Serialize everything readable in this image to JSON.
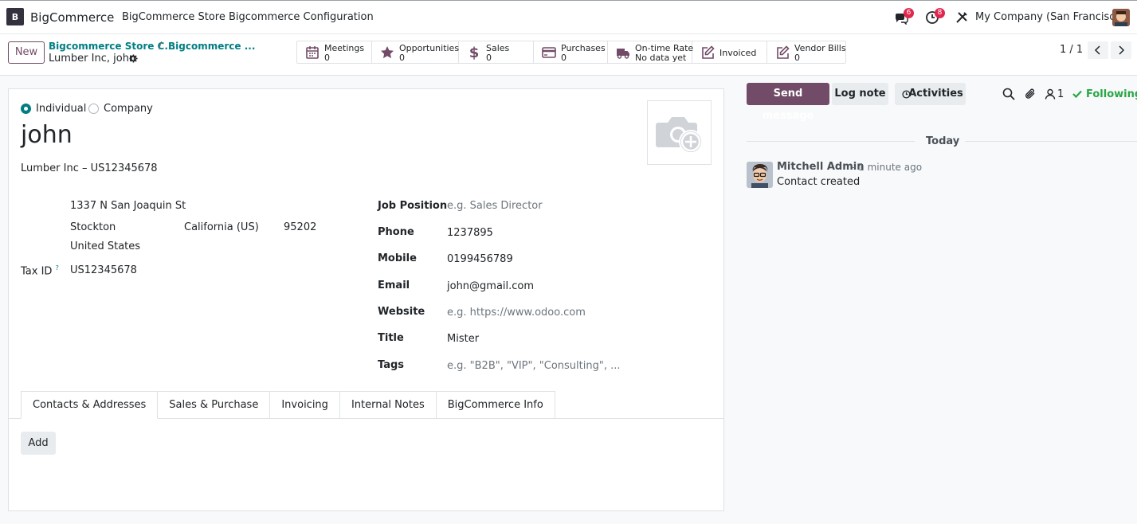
{
  "navbar": {
    "logo_letter": "B",
    "app_name": "BigCommerce",
    "menus": [
      "BigCommerce Store",
      "Bigcommerce Configuration"
    ],
    "messages_count": "6",
    "activities_count": "8",
    "company": "My Company (San Francisco)"
  },
  "control": {
    "new_label": "New",
    "breadcrumb_1": "Bigcommerce Store C...",
    "breadcrumb_2": "Bigcommerce ...",
    "separator": "/",
    "current": "Lumber Inc, john",
    "pager": "1 / 1"
  },
  "smart_buttons": [
    {
      "label": "Meetings",
      "value": "0",
      "icon": "calendar-icon"
    },
    {
      "label": "Opportunities",
      "value": "0",
      "icon": "star-icon"
    },
    {
      "label": "Sales",
      "value": "0",
      "icon": "dollar-icon"
    },
    {
      "label": "Purchases",
      "value": "0",
      "icon": "credit-card-icon"
    },
    {
      "label": "On-time Rate",
      "value": "No data yet",
      "icon": "truck-icon"
    },
    {
      "label": "Invoiced",
      "value": "",
      "icon": "pencil-square-icon"
    },
    {
      "label": "Vendor Bills",
      "value": "0",
      "icon": "pencil-square-icon"
    }
  ],
  "form": {
    "type_individual": "Individual",
    "type_company": "Company",
    "name": "john",
    "parent": "Lumber Inc – US12345678",
    "street": "1337 N San Joaquin St",
    "city": "Stockton",
    "state": "California (US)",
    "zip": "95202",
    "country": "United States",
    "tax_label": "Tax ID",
    "tax_help": "?",
    "tax_value": "US12345678",
    "fields": [
      {
        "label": "Job Position",
        "value": "e.g. Sales Director",
        "placeholder": true
      },
      {
        "label": "Phone",
        "value": "1237895",
        "placeholder": false
      },
      {
        "label": "Mobile",
        "value": "0199456789",
        "placeholder": false
      },
      {
        "label": "Email",
        "value": "john@gmail.com",
        "placeholder": false
      },
      {
        "label": "Website",
        "value": "e.g. https://www.odoo.com",
        "placeholder": true
      },
      {
        "label": "Title",
        "value": "Mister",
        "placeholder": false
      },
      {
        "label": "Tags",
        "value": "e.g. \"B2B\", \"VIP\", \"Consulting\", ...",
        "placeholder": true
      }
    ],
    "tabs": [
      "Contacts & Addresses",
      "Sales & Purchase",
      "Invoicing",
      "Internal Notes",
      "BigCommerce Info"
    ],
    "add_label": "Add"
  },
  "chatter": {
    "send_message": "Send message",
    "log_note": "Log note",
    "activities": "Activities",
    "followers_count": "1",
    "following": "Following",
    "date_separator": "Today",
    "messages": [
      {
        "author": "Mitchell Admin",
        "time": "- 1 minute ago",
        "body": "Contact created"
      }
    ]
  },
  "colors": {
    "primary": "#714b67",
    "link": "#017e84",
    "following": "#28a745",
    "badge": "#e0284e"
  }
}
